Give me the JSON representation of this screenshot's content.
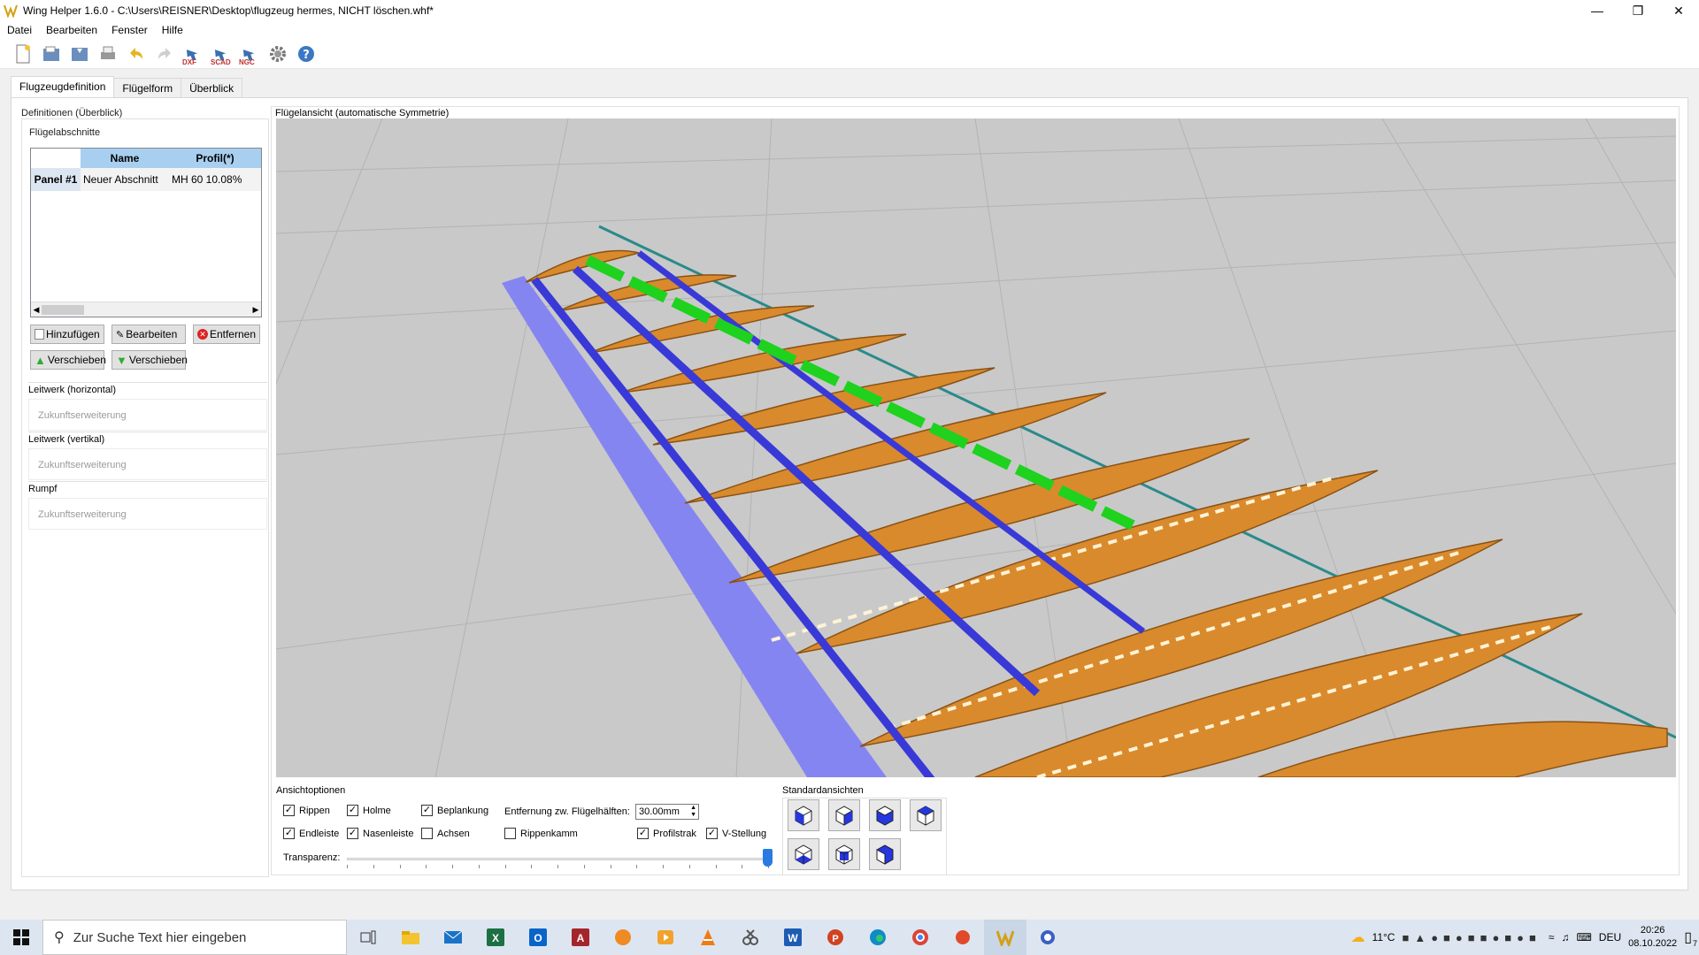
{
  "window": {
    "title": "Wing Helper 1.6.0 - C:\\Users\\REISNER\\Desktop\\flugzeug hermes, NICHT löschen.whf*"
  },
  "menu": [
    "Datei",
    "Bearbeiten",
    "Fenster",
    "Hilfe"
  ],
  "toolbar": {
    "dxf": "DXF",
    "scad": "SCAD",
    "ngc": "NGC"
  },
  "tabs": [
    "Flugzeugdefinition",
    "Flügelform",
    "Überblick"
  ],
  "left": {
    "overview_title": "Definitionen (Überblick)",
    "sections_title": "Flügelabschnitte",
    "table": {
      "headers": [
        "Name",
        "Profil(*)"
      ],
      "rows": [
        {
          "id": "Panel #1",
          "name": "Neuer Abschnitt",
          "profile": "MH 60  10.08%"
        }
      ]
    },
    "buttons": {
      "add": "Hinzufügen",
      "edit": "Bearbeiten",
      "remove": "Entfernen",
      "move_up": "Verschieben",
      "move_down": "Verschieben"
    },
    "htail": {
      "title": "Leitwerk (horizontal)",
      "text": "Zukunftserweiterung"
    },
    "vtail": {
      "title": "Leitwerk (vertikal)",
      "text": "Zukunftserweiterung"
    },
    "fuselage": {
      "title": "Rumpf",
      "text": "Zukunftserweiterung"
    }
  },
  "view": {
    "title": "Flügelansicht (automatische Symmetrie)"
  },
  "options": {
    "title": "Ansichtoptionen",
    "checkboxes": [
      {
        "label": "Rippen",
        "checked": true
      },
      {
        "label": "Holme",
        "checked": true
      },
      {
        "label": "Beplankung",
        "checked": true
      },
      {
        "label": "Endleiste",
        "checked": true
      },
      {
        "label": "Nasenleiste",
        "checked": true
      },
      {
        "label": "Achsen",
        "checked": false
      },
      {
        "label": "Rippenkamm",
        "checked": false
      },
      {
        "label": "Profilstrak",
        "checked": true
      },
      {
        "label": "V-Stellung",
        "checked": true
      }
    ],
    "distance_label": "Entfernung zw. Flügelhälften:",
    "distance_value": "30.00mm",
    "transparency_label": "Transparenz:",
    "transparency_value": 1.0
  },
  "standard_views": {
    "title": "Standardansichten"
  },
  "taskbar": {
    "search_placeholder": "Zur Suche Text hier eingeben",
    "temperature": "11°C",
    "language": "DEU",
    "time": "20:26",
    "date": "08.10.2022",
    "notifications": "7"
  }
}
